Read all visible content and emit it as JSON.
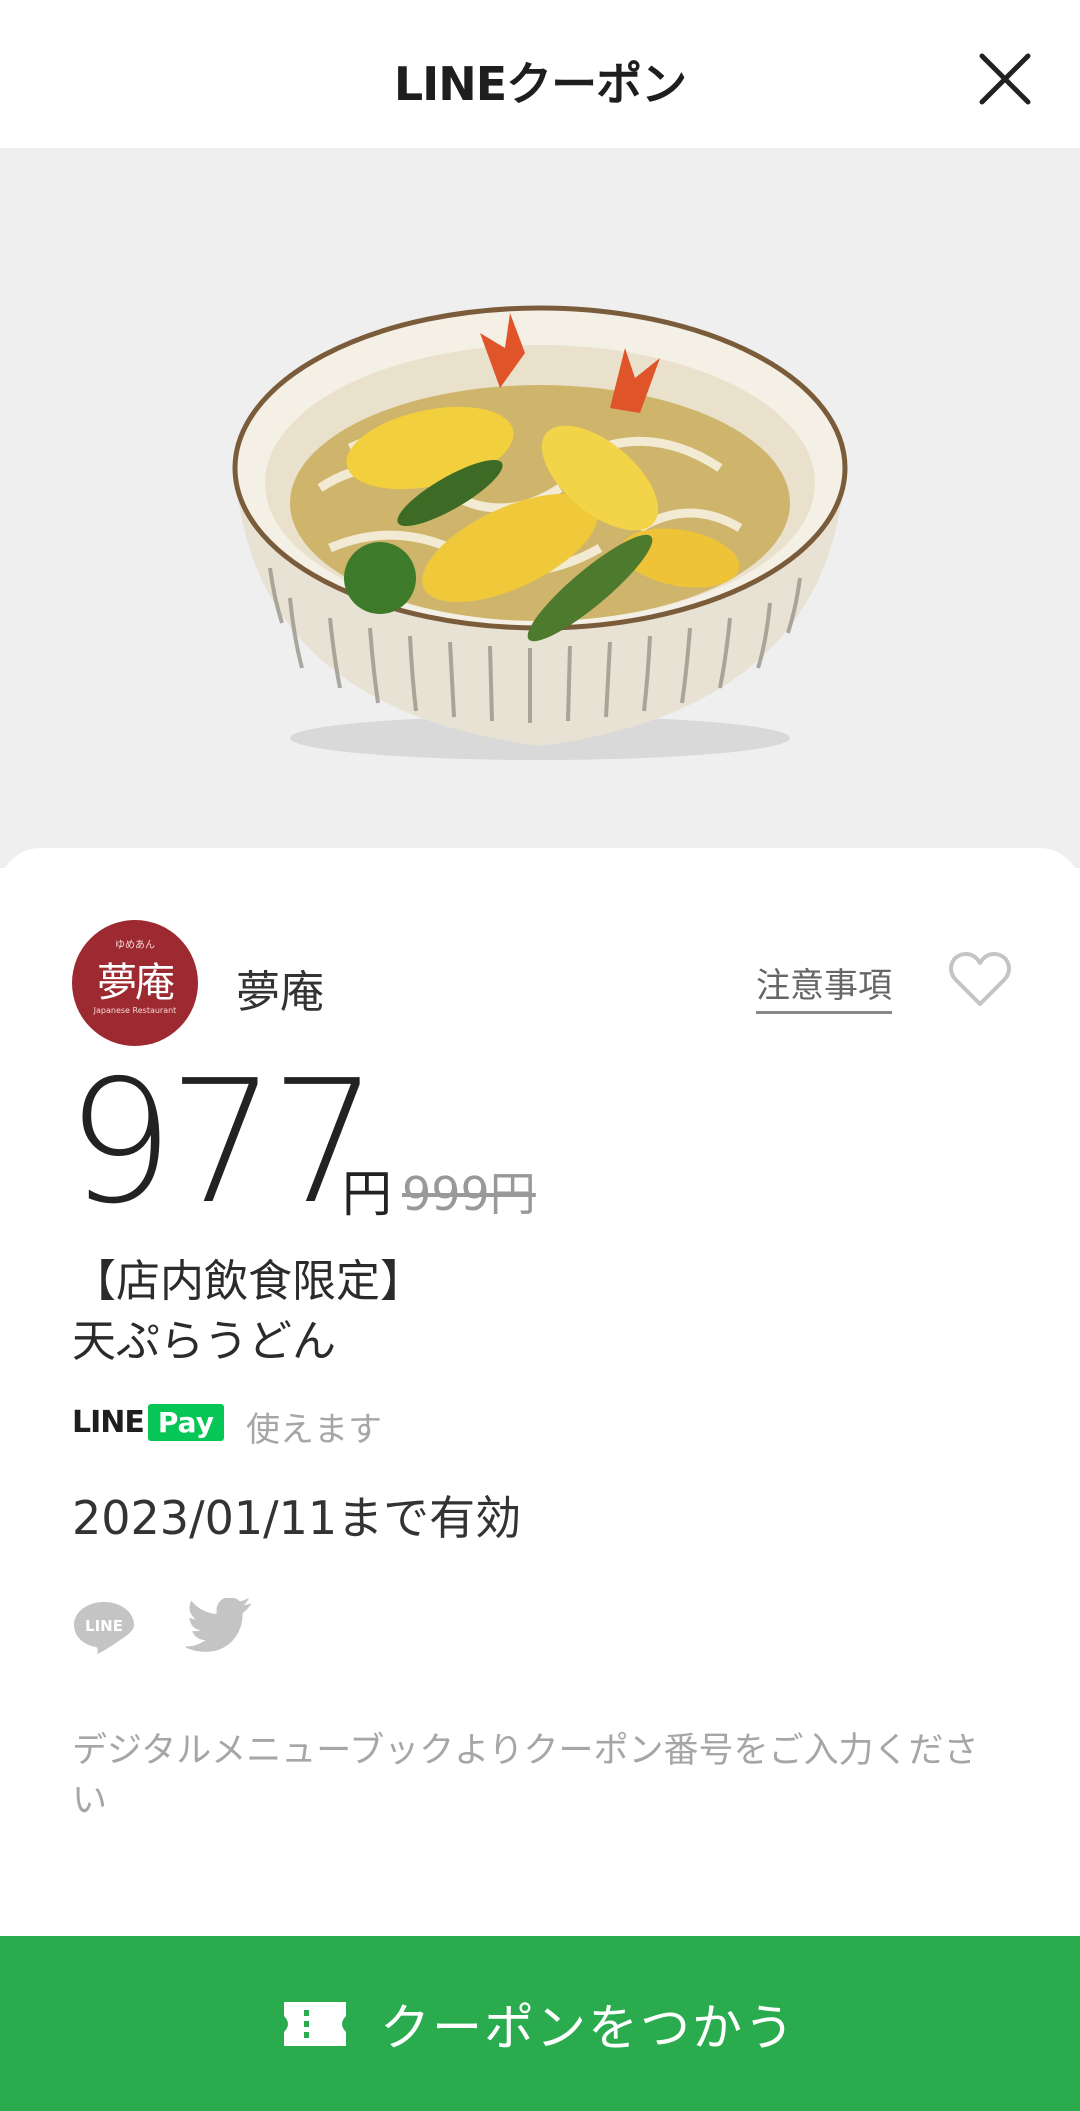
{
  "header": {
    "title": "LINEクーポン",
    "close_icon": "close-icon"
  },
  "hero": {
    "image_alt": "天ぷらうどん"
  },
  "shop": {
    "logo_text": "夢庵",
    "logo_ruby": "ゆめあん",
    "logo_sub": "Japanese Restaurant",
    "name": "夢庵",
    "notice_label": "注意事項",
    "favorite_icon": "heart-outline-icon"
  },
  "price": {
    "value": "977",
    "unit": "円",
    "original": "999円"
  },
  "coupon": {
    "title_line1": "【店内飲食限定】",
    "title_line2": "天ぷらうどん"
  },
  "payment": {
    "line_label": "LINE",
    "pay_label": "Pay",
    "usable_label": "使えます"
  },
  "validity": "2023/01/11まで有効",
  "share": {
    "line_icon": "line-share-icon",
    "line_icon_text": "LINE",
    "twitter_icon": "twitter-bird-icon"
  },
  "note": "デジタルメニューブックよりクーポン番号をご入力ください",
  "use_button": {
    "label": "クーポンをつかう",
    "icon": "ticket-icon"
  },
  "colors": {
    "brand_green": "#2aac4e",
    "line_pay_green": "#06c755",
    "logo_red": "#9e2a31",
    "hero_bg": "#efefef"
  }
}
